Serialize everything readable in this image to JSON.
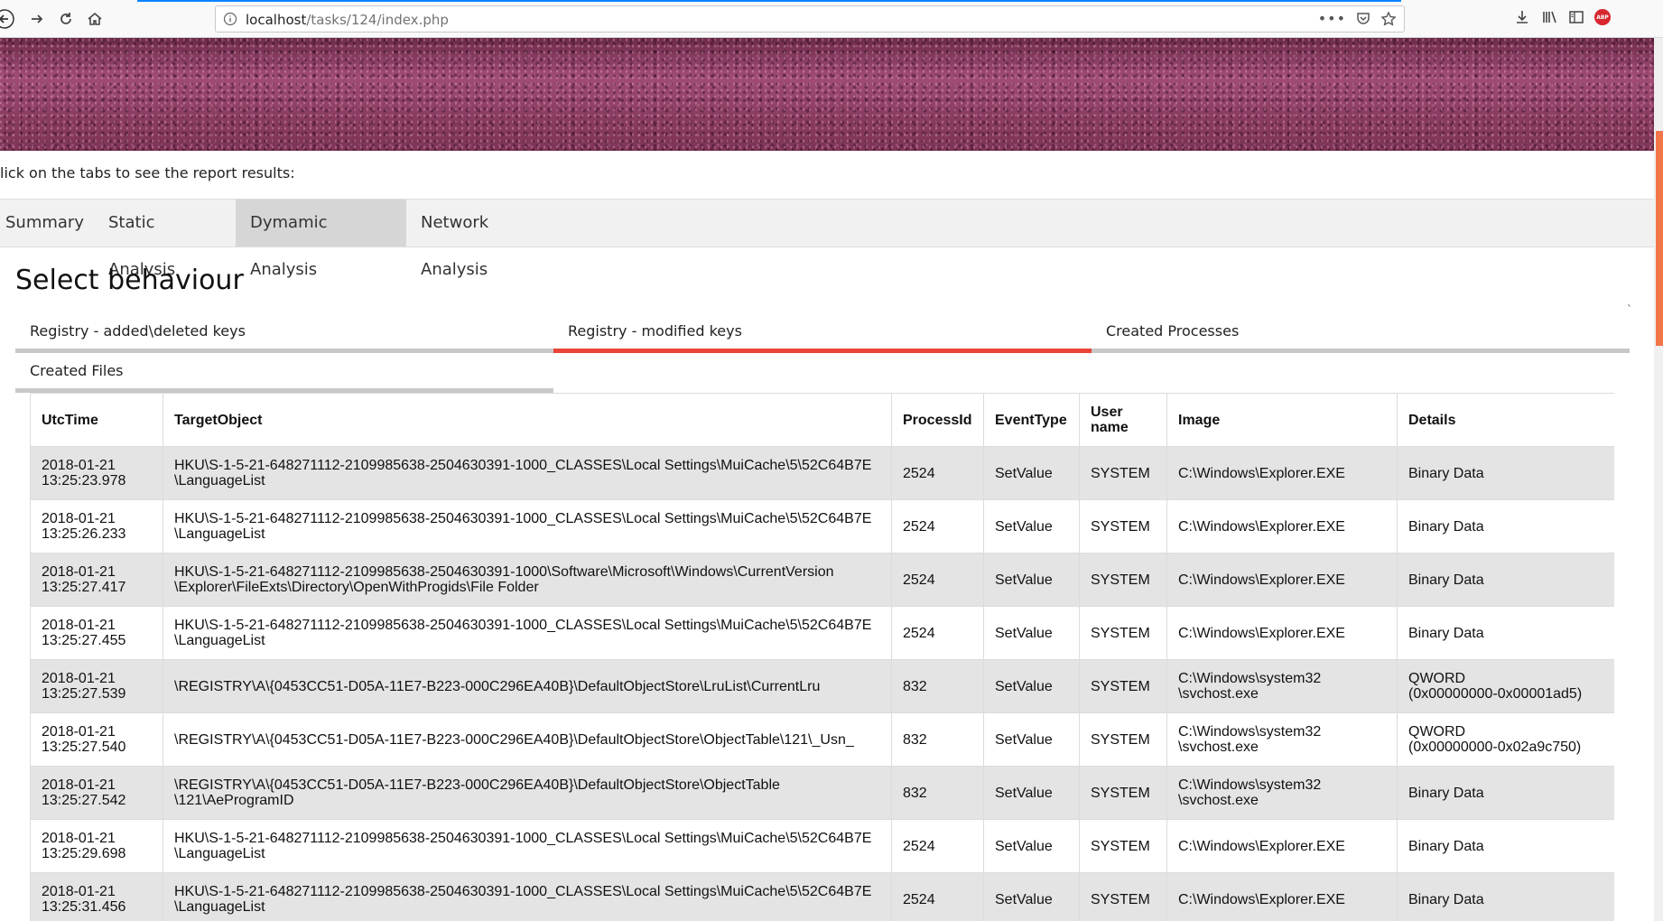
{
  "browser": {
    "url_host": "localhost",
    "url_path": "/tasks/124/index.php"
  },
  "page": {
    "instruction": "lick on the tabs to see the report results:",
    "main_tabs": [
      "Summary",
      "Static Analysis",
      "Dymamic Analysis",
      "Network Analysis"
    ],
    "active_main_tab": "Dymamic Analysis",
    "section_title": "Select behaviour",
    "sub_tabs": [
      "Registry - added\\deleted keys",
      "Registry - modified keys",
      "Created Processes",
      "Created Files"
    ],
    "active_sub_tab": "Registry - modified keys"
  },
  "table": {
    "headers": [
      "UtcTime",
      "TargetObject",
      "ProcessId",
      "EventType",
      "User name",
      "Image",
      "Details"
    ],
    "rows": [
      {
        "time": "2018-01-21\n13:25:23.978",
        "target": "HKU\\S-1-5-21-648271112-2109985638-2504630391-1000_CLASSES\\Local Settings\\MuiCache\\5\\52C64B7E\n\\LanguageList",
        "pid": "2524",
        "event": "SetValue",
        "user": "SYSTEM",
        "image": "C:\\Windows\\Explorer.EXE",
        "details": "Binary Data"
      },
      {
        "time": "2018-01-21\n13:25:26.233",
        "target": "HKU\\S-1-5-21-648271112-2109985638-2504630391-1000_CLASSES\\Local Settings\\MuiCache\\5\\52C64B7E\n\\LanguageList",
        "pid": "2524",
        "event": "SetValue",
        "user": "SYSTEM",
        "image": "C:\\Windows\\Explorer.EXE",
        "details": "Binary Data"
      },
      {
        "time": "2018-01-21\n13:25:27.417",
        "target": "HKU\\S-1-5-21-648271112-2109985638-2504630391-1000\\Software\\Microsoft\\Windows\\CurrentVersion\n\\Explorer\\FileExts\\Directory\\OpenWithProgids\\File Folder",
        "pid": "2524",
        "event": "SetValue",
        "user": "SYSTEM",
        "image": "C:\\Windows\\Explorer.EXE",
        "details": "Binary Data"
      },
      {
        "time": "2018-01-21\n13:25:27.455",
        "target": "HKU\\S-1-5-21-648271112-2109985638-2504630391-1000_CLASSES\\Local Settings\\MuiCache\\5\\52C64B7E\n\\LanguageList",
        "pid": "2524",
        "event": "SetValue",
        "user": "SYSTEM",
        "image": "C:\\Windows\\Explorer.EXE",
        "details": "Binary Data"
      },
      {
        "time": "2018-01-21\n13:25:27.539",
        "target": "\\REGISTRY\\A\\{0453CC51-D05A-11E7-B223-000C296EA40B}\\DefaultObjectStore\\LruList\\CurrentLru",
        "pid": "832",
        "event": "SetValue",
        "user": "SYSTEM",
        "image": "C:\\Windows\\system32\n\\svchost.exe",
        "details": "QWORD\n(0x00000000-0x00001ad5)"
      },
      {
        "time": "2018-01-21\n13:25:27.540",
        "target": "\\REGISTRY\\A\\{0453CC51-D05A-11E7-B223-000C296EA40B}\\DefaultObjectStore\\ObjectTable\\121\\_Usn_",
        "pid": "832",
        "event": "SetValue",
        "user": "SYSTEM",
        "image": "C:\\Windows\\system32\n\\svchost.exe",
        "details": "QWORD\n(0x00000000-0x02a9c750)"
      },
      {
        "time": "2018-01-21\n13:25:27.542",
        "target": "\\REGISTRY\\A\\{0453CC51-D05A-11E7-B223-000C296EA40B}\\DefaultObjectStore\\ObjectTable\n\\121\\AeProgramID",
        "pid": "832",
        "event": "SetValue",
        "user": "SYSTEM",
        "image": "C:\\Windows\\system32\n\\svchost.exe",
        "details": "Binary Data"
      },
      {
        "time": "2018-01-21\n13:25:29.698",
        "target": "HKU\\S-1-5-21-648271112-2109985638-2504630391-1000_CLASSES\\Local Settings\\MuiCache\\5\\52C64B7E\n\\LanguageList",
        "pid": "2524",
        "event": "SetValue",
        "user": "SYSTEM",
        "image": "C:\\Windows\\Explorer.EXE",
        "details": "Binary Data"
      },
      {
        "time": "2018-01-21\n13:25:31.456",
        "target": "HKU\\S-1-5-21-648271112-2109985638-2504630391-1000_CLASSES\\Local Settings\\MuiCache\\5\\52C64B7E\n\\LanguageList",
        "pid": "2524",
        "event": "SetValue",
        "user": "SYSTEM",
        "image": "C:\\Windows\\Explorer.EXE",
        "details": "Binary Data"
      }
    ]
  },
  "colors": {
    "active_subtab_underline": "#e8443a",
    "scroll_thumb": "#f2764a",
    "row_shade": "#e4e4e4"
  },
  "icons": [
    "back-icon",
    "forward-icon",
    "reload-icon",
    "home-icon",
    "info-icon",
    "more-icon",
    "pocket-icon",
    "bookmark-star-icon",
    "download-icon",
    "library-icon",
    "sidebar-icon",
    "adblock-icon"
  ]
}
